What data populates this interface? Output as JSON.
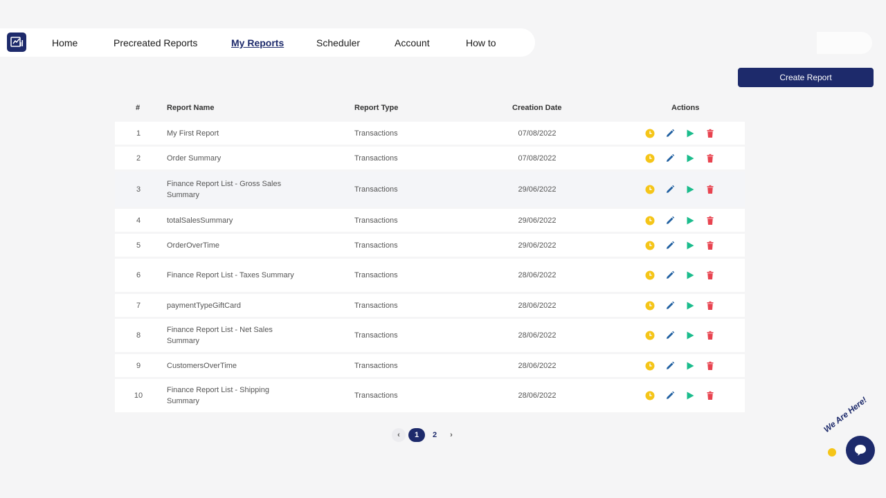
{
  "nav": {
    "items": [
      {
        "label": "Home"
      },
      {
        "label": "Precreated Reports"
      },
      {
        "label": "My Reports",
        "active": true
      },
      {
        "label": "Scheduler"
      },
      {
        "label": "Account"
      },
      {
        "label": "How to"
      }
    ],
    "logo_icon": "report-logo-icon"
  },
  "toolbar": {
    "create_label": "Create Report"
  },
  "table": {
    "headers": [
      "#",
      "Report Name",
      "Report Type",
      "Creation Date",
      "Actions"
    ],
    "rows": [
      {
        "num": "1",
        "name": "My First Report",
        "type": "Transactions",
        "date": "07/08/2022"
      },
      {
        "num": "2",
        "name": "Order Summary",
        "type": "Transactions",
        "date": "07/08/2022"
      },
      {
        "num": "3",
        "name": "Finance Report List - Gross Sales Summary",
        "type": "Transactions",
        "date": "29/06/2022"
      },
      {
        "num": "4",
        "name": "totalSalesSummary",
        "type": "Transactions",
        "date": "29/06/2022"
      },
      {
        "num": "5",
        "name": "OrderOverTime",
        "type": "Transactions",
        "date": "29/06/2022"
      },
      {
        "num": "6",
        "name": "Finance Report List - Taxes Summary",
        "type": "Transactions",
        "date": "28/06/2022"
      },
      {
        "num": "7",
        "name": "paymentTypeGiftCard",
        "type": "Transactions",
        "date": "28/06/2022"
      },
      {
        "num": "8",
        "name": "Finance Report List - Net Sales Summary",
        "type": "Transactions",
        "date": "28/06/2022"
      },
      {
        "num": "9",
        "name": "CustomersOverTime",
        "type": "Transactions",
        "date": "28/06/2022"
      },
      {
        "num": "10",
        "name": "Finance Report List - Shipping Summary",
        "type": "Transactions",
        "date": "28/06/2022"
      }
    ],
    "action_icons": [
      "clock-icon",
      "edit-icon",
      "play-icon",
      "trash-icon"
    ]
  },
  "pagination": {
    "pages": [
      "1",
      "2"
    ],
    "current": "1",
    "prev_icon": "chevron-left-icon",
    "next_icon": "chevron-right-icon"
  },
  "chat": {
    "label": "We Are Here!",
    "icon": "chat-bubble-icon"
  },
  "colors": {
    "brand": "#1d2a6b",
    "clock": "#f5c518",
    "edit": "#1f5fa0",
    "play": "#1bbc8c",
    "trash": "#e8434f"
  }
}
